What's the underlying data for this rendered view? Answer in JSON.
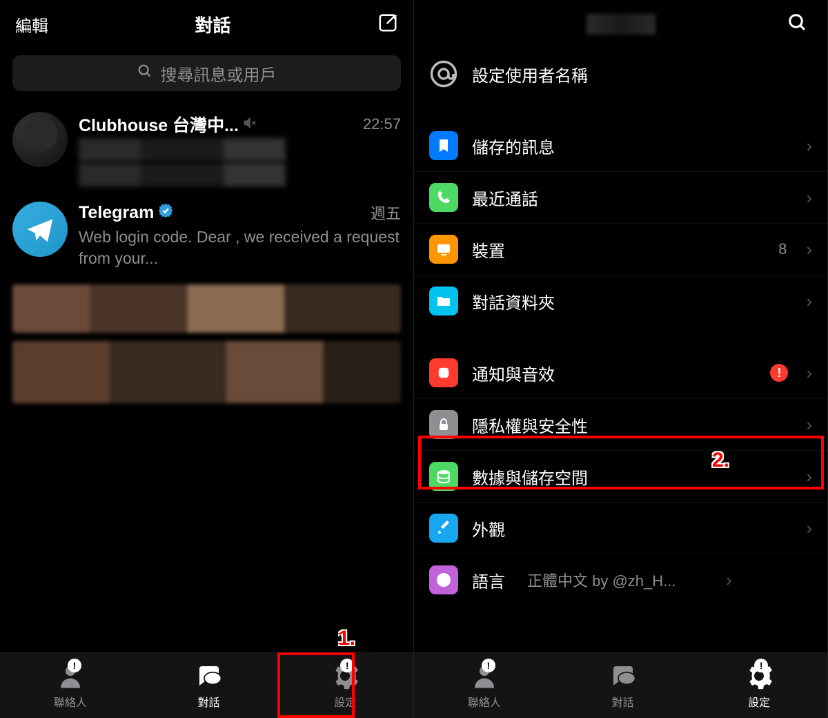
{
  "left": {
    "header": {
      "edit": "編輯",
      "title": "對話"
    },
    "search_placeholder": "搜尋訊息或用戶",
    "chats": [
      {
        "name": "Clubhouse 台灣中...",
        "muted": true,
        "time": "22:57",
        "preview": ""
      },
      {
        "name": "Telegram",
        "verified": true,
        "time": "週五",
        "preview": "Web login code. Dear          , we received a request from your..."
      }
    ],
    "tabs": {
      "contacts": "聯絡人",
      "chats": "對話",
      "settings": "設定"
    }
  },
  "right": {
    "username_row": "設定使用者名稱",
    "group1": [
      {
        "icon": "bookmark",
        "color": "#007aff",
        "label": "儲存的訊息"
      },
      {
        "icon": "phone",
        "color": "#4cd964",
        "label": "最近通話"
      },
      {
        "icon": "device",
        "color": "#ff9500",
        "label": "裝置",
        "value": "8"
      },
      {
        "icon": "folder",
        "color": "#00c4f0",
        "label": "對話資料夾"
      }
    ],
    "group2": [
      {
        "icon": "bell",
        "color": "#ff3b30",
        "label": "通知與音效",
        "alert": true
      },
      {
        "icon": "lock",
        "color": "#8e8e93",
        "label": "隱私權與安全性"
      },
      {
        "icon": "data",
        "color": "#4cd964",
        "label": "數據與儲存空間"
      },
      {
        "icon": "brush",
        "color": "#17a6ef",
        "label": "外觀"
      },
      {
        "icon": "globe",
        "color": "#c062dc",
        "label": "語言",
        "value": "正體中文 by @zh_H..."
      }
    ],
    "tabs": {
      "contacts": "聯絡人",
      "chats": "對話",
      "settings": "設定"
    }
  },
  "annotations": {
    "step1": "1.",
    "step2": "2."
  }
}
